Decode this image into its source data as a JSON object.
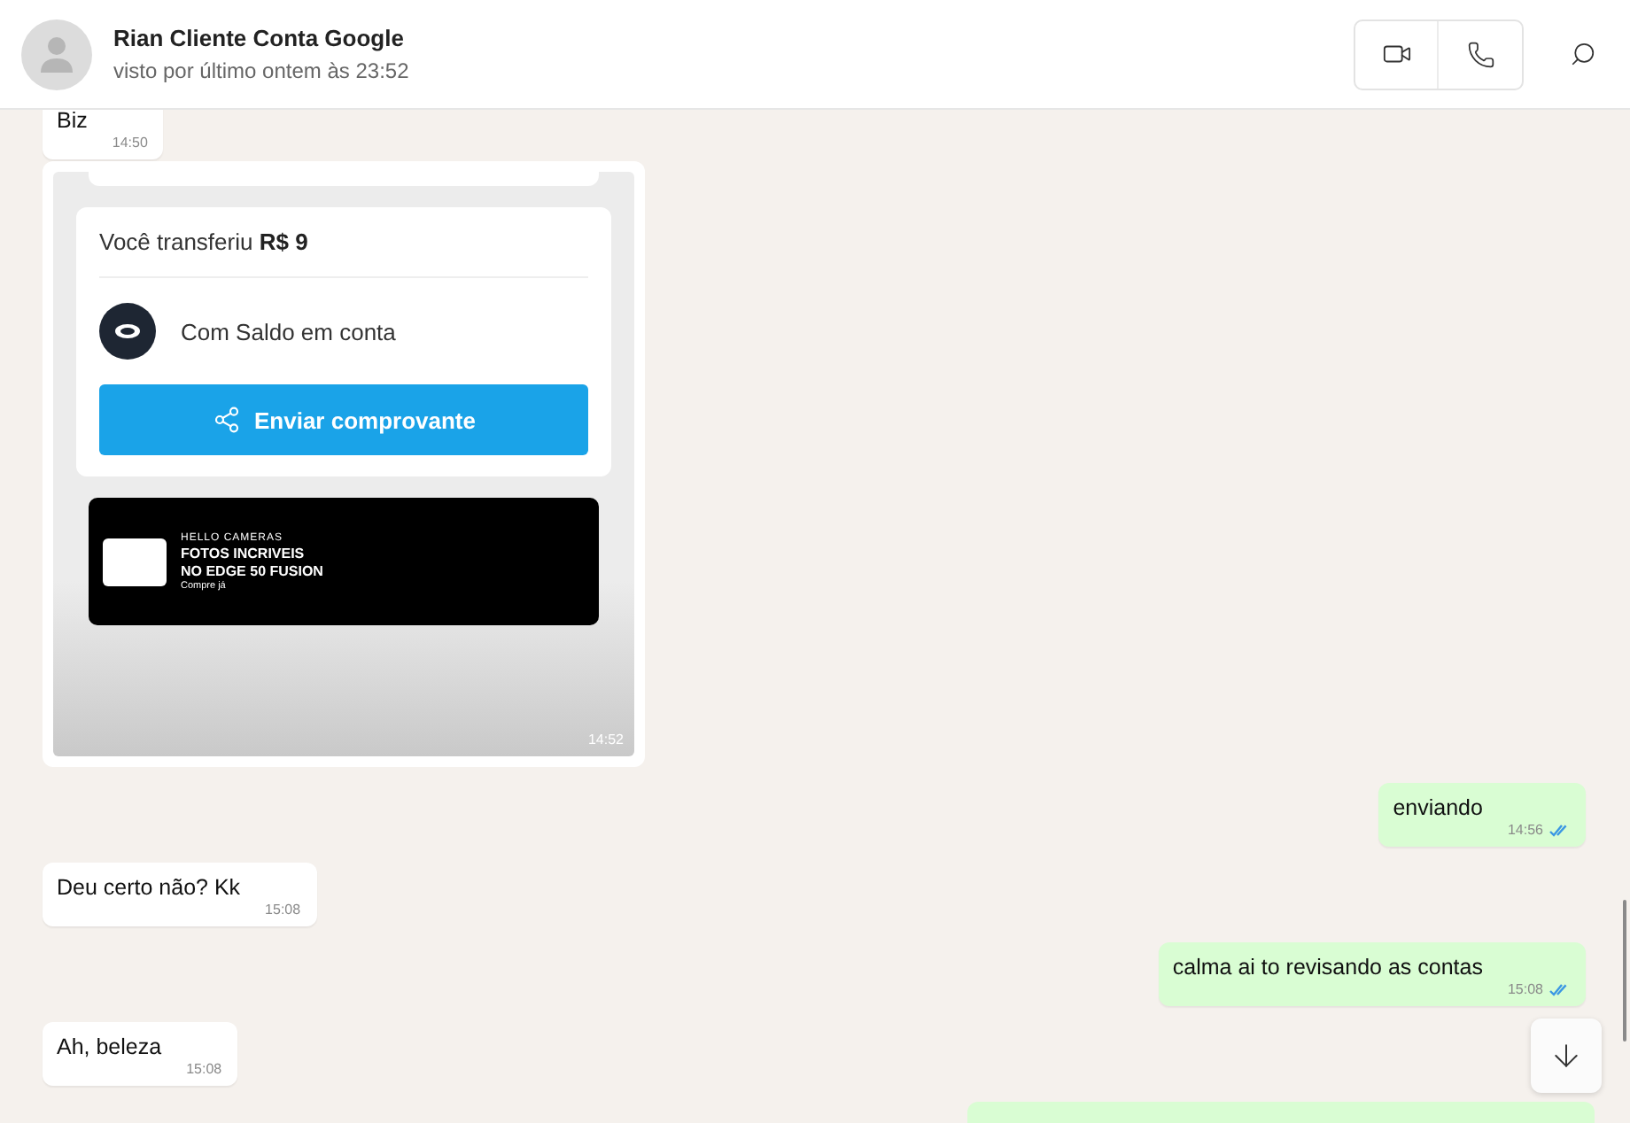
{
  "contact": {
    "name": "Rian Cliente Conta Google",
    "status": "visto por último ontem às 23:52"
  },
  "messages": [
    {
      "kind": "text",
      "outgoing": false,
      "text": "Biz",
      "time": "14:50"
    },
    {
      "kind": "image",
      "outgoing": false,
      "time": "14:52",
      "receipt": {
        "label": "Você transferiu",
        "amount": "R$ 9",
        "method": "Com Saldo em conta",
        "button": "Enviar comprovante",
        "ad": {
          "eyebrow": "HELLO CAMERAS",
          "title_lines": [
            "FOTOS INCRIVEIS",
            "NO EDGE 50 FUSION"
          ],
          "cta": "Compre já"
        }
      }
    },
    {
      "kind": "text",
      "outgoing": true,
      "text": "enviando",
      "time": "14:56",
      "read": true
    },
    {
      "kind": "text",
      "outgoing": false,
      "text": "Deu certo não? Kk",
      "time": "15:08"
    },
    {
      "kind": "text",
      "outgoing": true,
      "text": "calma ai to revisando as contas",
      "time": "15:08",
      "read": true
    },
    {
      "kind": "text",
      "outgoing": false,
      "text": "Ah, beleza",
      "time": "15:08"
    },
    {
      "kind": "cut",
      "outgoing": true
    }
  ]
}
